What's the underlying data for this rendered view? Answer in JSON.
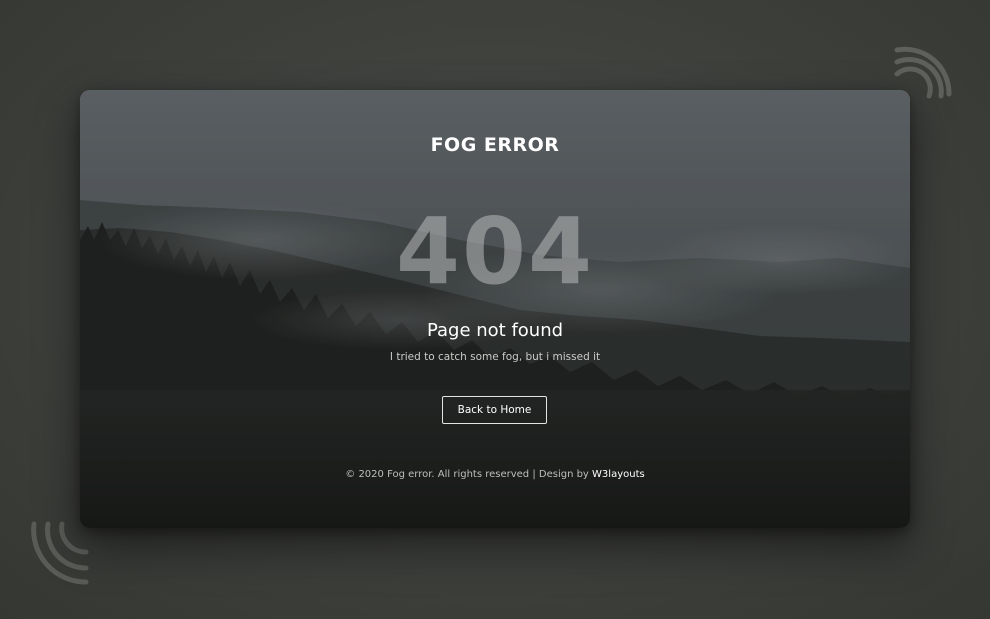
{
  "brand": {
    "title": "FOG ERROR"
  },
  "error": {
    "code": "404",
    "title": "Page not found",
    "message": "I tried to catch some fog, but i missed it"
  },
  "actions": {
    "home_button": "Back to Home"
  },
  "footer": {
    "copyright": "© 2020 Fog error. All rights reserved | Design by ",
    "designer_link": "W3layouts"
  },
  "colors": {
    "page_background": "#3e403c",
    "text_primary": "#ffffff",
    "text_muted": "#c9cbc9",
    "code_overlay": "rgba(185,188,188,0.55)",
    "button_border": "#e4e4e4"
  },
  "icons": {
    "top_right": "wifi-arc-icon",
    "bottom_left": "wifi-arc-icon"
  }
}
